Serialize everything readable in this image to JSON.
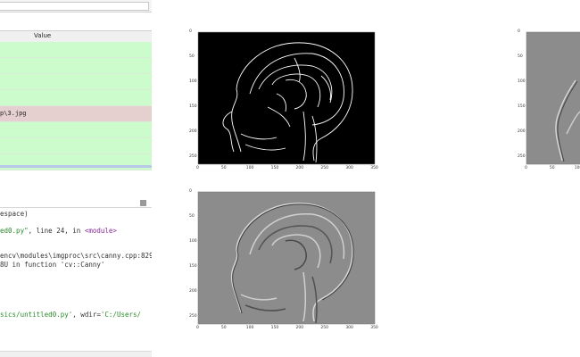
{
  "variable_explorer": {
    "column_value": "Value",
    "rows": [
      {
        "text": "",
        "state": "green"
      },
      {
        "text": "",
        "state": "green"
      },
      {
        "text": "",
        "state": "green"
      },
      {
        "text": "",
        "state": "green"
      },
      {
        "text": "p\\3.jpg",
        "state": "pink"
      },
      {
        "text": "",
        "state": "green"
      },
      {
        "text": "",
        "state": "green"
      },
      {
        "text": "",
        "state": "green"
      }
    ]
  },
  "console": {
    "line1": "espace)",
    "line2_a": "ed0.py\"",
    "line2_b": ", line 24, in ",
    "line2_c": "<module>",
    "line3": "encv\\modules\\imgproc\\src\\canny.cpp:829:",
    "line4": "8U in function 'cv::Canny'",
    "line5_a": "sics/untitled0.py'",
    "line5_b": ", wdir=",
    "line5_c": "'C:/Users/"
  },
  "plots": {
    "y_ticks": [
      "0",
      "50",
      "100",
      "150",
      "200",
      "250"
    ],
    "x_ticks": [
      "0",
      "50",
      "100",
      "150",
      "200",
      "250",
      "300",
      "350"
    ],
    "right_partial_x_ticks": [
      "0",
      "50",
      "100"
    ]
  },
  "colors": {
    "row_green": "#ccfbcc",
    "row_pink": "#e6cfcf",
    "emboss_gray": "#8c8c8c"
  }
}
